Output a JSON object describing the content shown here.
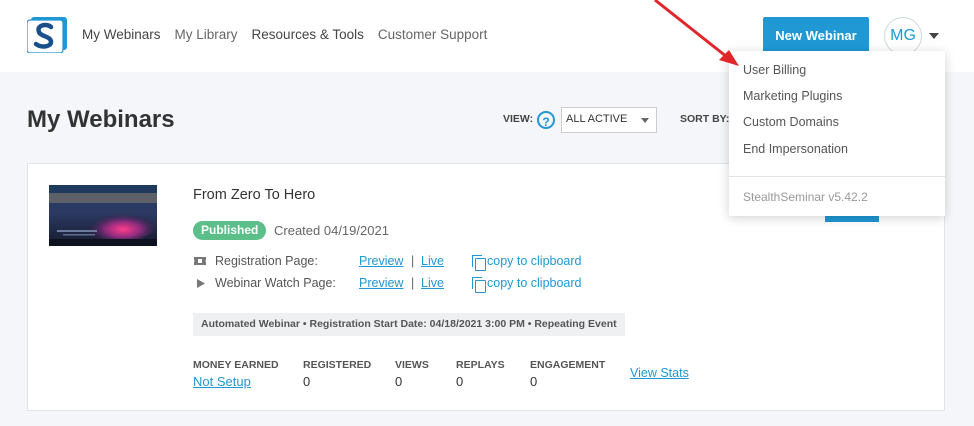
{
  "nav": {
    "items": [
      "My Webinars",
      "My Library",
      "Resources & Tools",
      "Customer Support"
    ]
  },
  "header": {
    "new_webinar_label": "New Webinar",
    "avatar_initials": "MG"
  },
  "page": {
    "title": "My Webinars",
    "view_label": "VIEW:",
    "help_glyph": "?",
    "view_selected": "ALL ACTIVE",
    "sort_label": "SORT BY:"
  },
  "webinar": {
    "title": "From Zero To Hero",
    "status": "Published",
    "created": "Created 04/19/2021",
    "registration_label": "Registration Page:",
    "watch_label": "Webinar Watch Page:",
    "preview_label": "Preview",
    "live_label": "Live",
    "separator": "|",
    "copy_label": "copy to clipboard",
    "info": "Automated Webinar • Registration Start Date: 04/18/2021 3:00 PM • Repeating Event",
    "stats": [
      {
        "label": "MONEY EARNED",
        "value": "Not Setup"
      },
      {
        "label": "REGISTERED",
        "value": "0"
      },
      {
        "label": "VIEWS",
        "value": "0"
      },
      {
        "label": "REPLAYS",
        "value": "0"
      },
      {
        "label": "ENGAGEMENT",
        "value": "0"
      }
    ],
    "view_stats_label": "View Stats"
  },
  "dropdown": {
    "items": [
      "User Billing",
      "Marketing Plugins",
      "Custom Domains",
      "End Impersonation"
    ],
    "version": "StealthSeminar v5.42.2"
  },
  "colors": {
    "accent": "#1f98d3",
    "published": "#5cbf8a",
    "annotation_arrow": "#e0262a"
  },
  "icons": {
    "registration": "ticket-icon",
    "watch": "play-icon",
    "copy": "copy-icon",
    "help": "help-circle-icon"
  }
}
